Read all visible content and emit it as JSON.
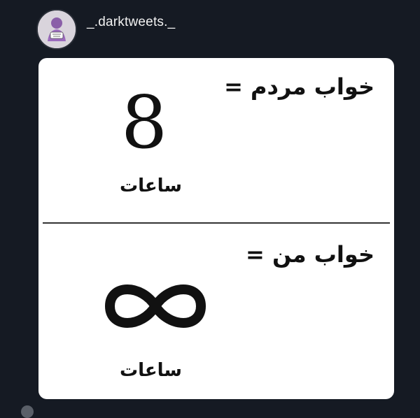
{
  "post": {
    "username": "_.darktweets._",
    "avatar_icon": "avatar-icon"
  },
  "meme": {
    "top_caption": "خواب مردم =",
    "top_value": "8",
    "top_unit": "ساعات",
    "bottom_caption": "خواب من =",
    "bottom_value_icon": "infinity-icon",
    "bottom_unit": "ساعات"
  },
  "colors": {
    "background": "#151a23",
    "card": "#ffffff",
    "text": "#111111"
  }
}
